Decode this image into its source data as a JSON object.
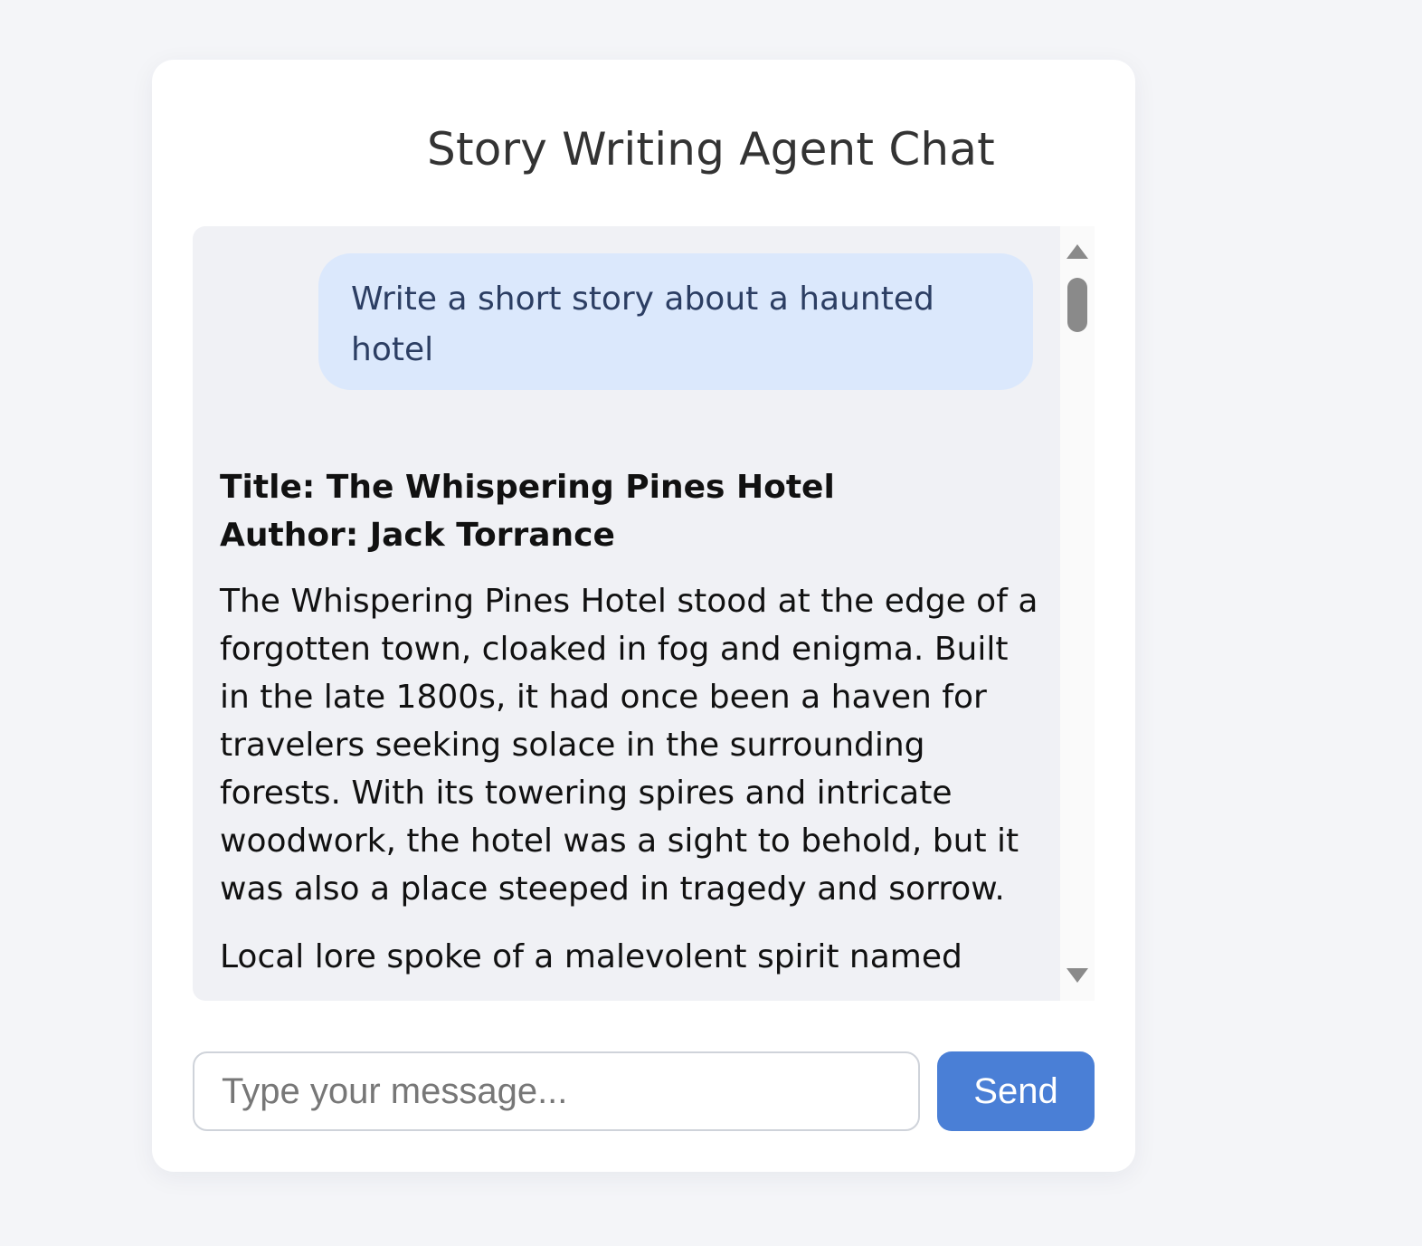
{
  "header": {
    "title": "Story Writing Agent Chat"
  },
  "chat": {
    "user_message": "Write a short story about a haunted hotel",
    "bot_message": {
      "title_line": "Title: The Whispering Pines Hotel",
      "author_line": "Author: Jack Torrance",
      "paragraphs": [
        "The Whispering Pines Hotel stood at the edge of a forgotten town, cloaked in fog and enigma. Built in the late 1800s, it had once been a haven for travelers seeking solace in the surrounding forests. With its towering spires and intricate woodwork, the hotel was a sight to behold, but it was also a place steeped in tragedy and sorrow.",
        "Local lore spoke of a malevolent spirit named"
      ]
    }
  },
  "composer": {
    "placeholder": "Type your message...",
    "value": "",
    "send_label": "Send"
  },
  "colors": {
    "accent": "#4a7fd6",
    "user_bubble": "#dbe8fc",
    "chat_background": "#f0f1f5",
    "page_background": "#f4f5f8"
  }
}
